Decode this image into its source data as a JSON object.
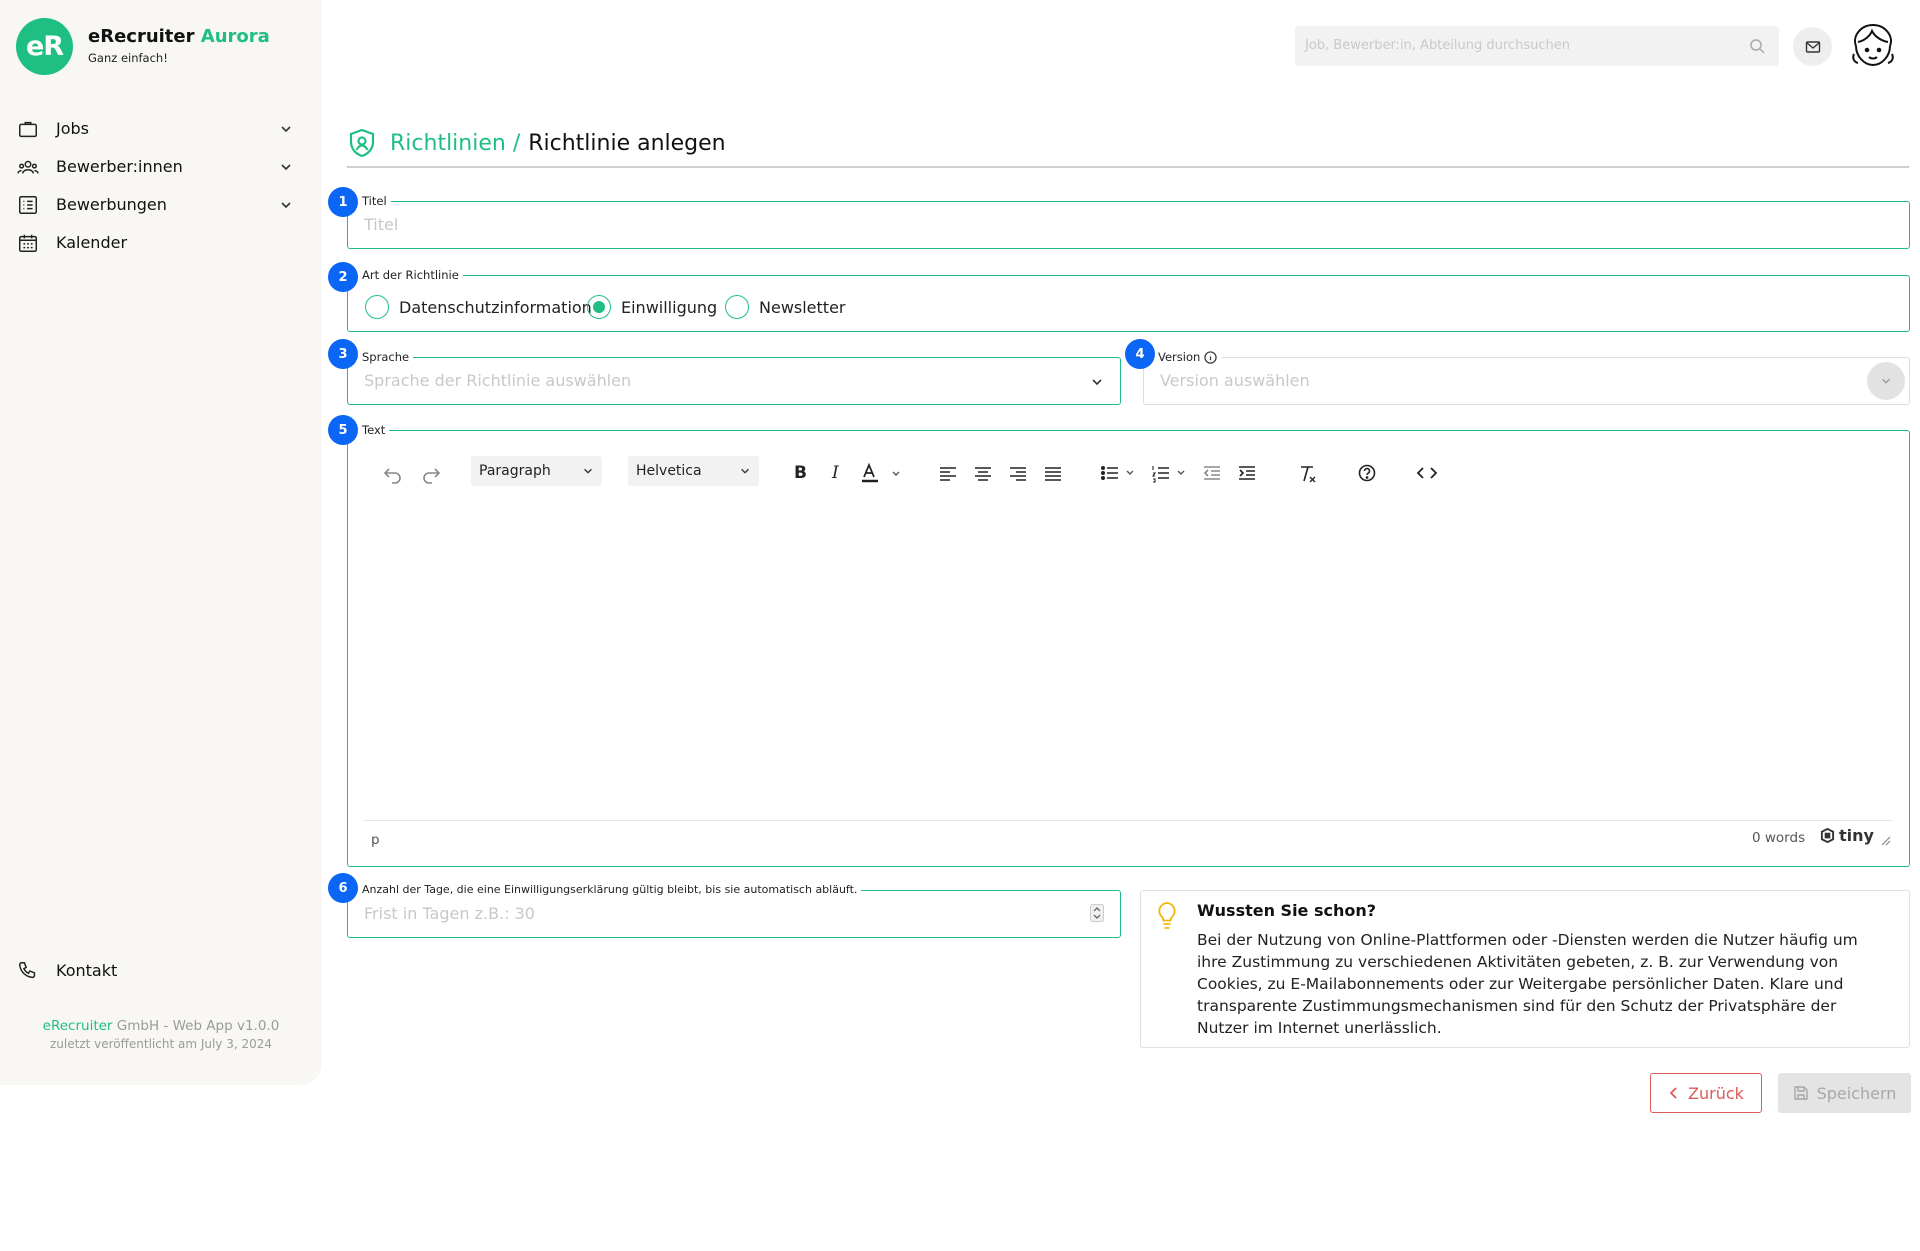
{
  "brand": {
    "logo_text": "eR",
    "name": "eRecruiter",
    "name_accent": "Aurora",
    "tagline": "Ganz einfach!"
  },
  "nav": {
    "items": [
      {
        "label": "Jobs",
        "icon": "briefcase-icon"
      },
      {
        "label": "Bewerber:innen",
        "icon": "users-icon"
      },
      {
        "label": "Bewerbungen",
        "icon": "list-icon"
      },
      {
        "label": "Kalender",
        "icon": "calendar-icon"
      }
    ],
    "contact": "Kontakt"
  },
  "footer": {
    "company_accent": "eRecruiter",
    "company_rest": " GmbH - Web App v1.0.0",
    "published": "zuletzt veröffentlicht am July 3, 2024"
  },
  "header": {
    "search_placeholder": "Job, Bewerber:in, Abteilung durchsuchen"
  },
  "page": {
    "breadcrumb": "Richtlinien /",
    "title": "Richtlinie anlegen"
  },
  "form": {
    "title": {
      "step": "1",
      "label": "Titel",
      "placeholder": "Titel",
      "value": ""
    },
    "type": {
      "step": "2",
      "label": "Art der Richtlinie",
      "options": [
        "Datenschutzinformation",
        "Einwilligung",
        "Newsletter"
      ],
      "selected": "Einwilligung"
    },
    "language": {
      "step": "3",
      "label": "Sprache",
      "placeholder": "Sprache der Richtlinie auswählen"
    },
    "version": {
      "step": "4",
      "label": "Version",
      "placeholder": "Version auswählen"
    },
    "text": {
      "step": "5",
      "label": "Text",
      "block_format": "Paragraph",
      "font": "Helvetica",
      "path": "p",
      "word_count": "0 words",
      "brand": "tiny"
    },
    "days": {
      "step": "6",
      "label": "Anzahl der Tage, die eine Einwilligungserklärung gültig bleibt, bis sie automatisch abläuft.",
      "placeholder": "Frist in Tagen z.B.: 30"
    }
  },
  "tip": {
    "title": "Wussten Sie schon?",
    "body": "Bei der Nutzung von Online-Plattformen oder -Diensten werden die Nutzer häufig um ihre Zustimmung zu verschiedenen Aktivitäten gebeten, z. B. zur Verwendung von Cookies, zu E-Mailabonnements oder zur Weitergabe persönlicher Daten. Klare und transparente Zustimmungsmechanismen sind für den Schutz der Privatsphäre der Nutzer im Internet unerlässlich."
  },
  "actions": {
    "back": "Zurück",
    "save": "Speichern"
  },
  "colors": {
    "accent": "#1fbf84",
    "step_badge": "#0b66f5",
    "danger": "#e05a5a"
  }
}
